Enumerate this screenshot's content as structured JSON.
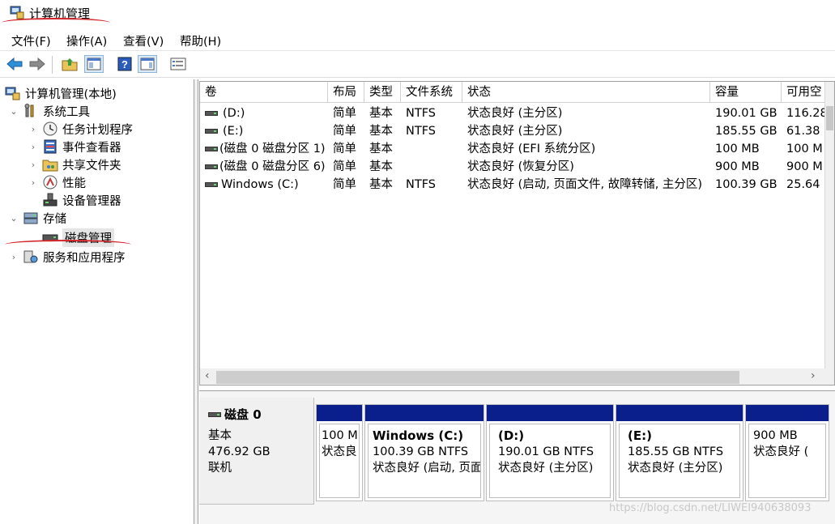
{
  "window": {
    "title": "计算机管理"
  },
  "menu": [
    "文件(F)",
    "操作(A)",
    "查看(V)",
    "帮助(H)"
  ],
  "toolbar": {
    "buttons": [
      "back-arrow-icon",
      "forward-arrow-icon",
      "up-folder-icon",
      "show-hide-tree-icon",
      "help-icon",
      "action-pane-icon",
      "properties-icon"
    ]
  },
  "tree": [
    {
      "label": "计算机管理(本地)",
      "icon": "computer-management-icon",
      "level": 0,
      "chevron": ""
    },
    {
      "label": "系统工具",
      "icon": "tools-icon",
      "level": 1,
      "chevron": "⌄"
    },
    {
      "label": "任务计划程序",
      "icon": "clock-icon",
      "level": 2,
      "chevron": "›"
    },
    {
      "label": "事件查看器",
      "icon": "event-viewer-icon",
      "level": 2,
      "chevron": "›"
    },
    {
      "label": "共享文件夹",
      "icon": "shared-folder-icon",
      "level": 2,
      "chevron": "›"
    },
    {
      "label": "性能",
      "icon": "performance-icon",
      "level": 2,
      "chevron": "›"
    },
    {
      "label": "设备管理器",
      "icon": "device-manager-icon",
      "level": 2,
      "chevron": ""
    },
    {
      "label": "存储",
      "icon": "storage-icon",
      "level": 1,
      "chevron": "⌄"
    },
    {
      "label": "磁盘管理",
      "icon": "disk-management-icon",
      "level": 2,
      "chevron": "",
      "selected": true
    },
    {
      "label": "服务和应用程序",
      "icon": "services-icon",
      "level": 1,
      "chevron": "›"
    }
  ],
  "volume_table": {
    "columns": [
      "卷",
      "布局",
      "类型",
      "文件系统",
      "状态",
      "容量",
      "可用空"
    ],
    "rows": [
      [
        "(D:)",
        "简单",
        "基本",
        "NTFS",
        "状态良好 (主分区)",
        "190.01 GB",
        "116.28"
      ],
      [
        "(E:)",
        "简单",
        "基本",
        "NTFS",
        "状态良好 (主分区)",
        "185.55 GB",
        "61.38"
      ],
      [
        "(磁盘 0 磁盘分区 1)",
        "简单",
        "基本",
        "",
        "状态良好 (EFI 系统分区)",
        "100 MB",
        "100 M"
      ],
      [
        "(磁盘 0 磁盘分区 6)",
        "简单",
        "基本",
        "",
        "状态良好 (恢复分区)",
        "900 MB",
        "900 M"
      ],
      [
        "Windows (C:)",
        "简单",
        "基本",
        "NTFS",
        "状态良好 (启动, 页面文件, 故障转储, 主分区)",
        "100.39 GB",
        "25.64"
      ]
    ]
  },
  "disk": {
    "name": "磁盘 0",
    "type": "基本",
    "size": "476.92 GB",
    "status": "联机",
    "partitions": [
      {
        "name": "",
        "size": "100 M",
        "status": "状态良"
      },
      {
        "name": "Windows  (C:)",
        "size": "100.39 GB NTFS",
        "status": "状态良好 (启动, 页面"
      },
      {
        "name": "(D:)",
        "size": "190.01 GB NTFS",
        "status": "状态良好 (主分区)"
      },
      {
        "name": "(E:)",
        "size": "185.55 GB NTFS",
        "status": "状态良好 (主分区)"
      },
      {
        "name": "",
        "size": "900 MB",
        "status": "状态良好 ("
      }
    ]
  },
  "watermark": "https://blog.csdn.net/LIWEI940638093",
  "colors": {
    "partition_bar": "#0a1e8c",
    "annotation_red": "#d4262a",
    "selection": "#e5e5e5"
  }
}
